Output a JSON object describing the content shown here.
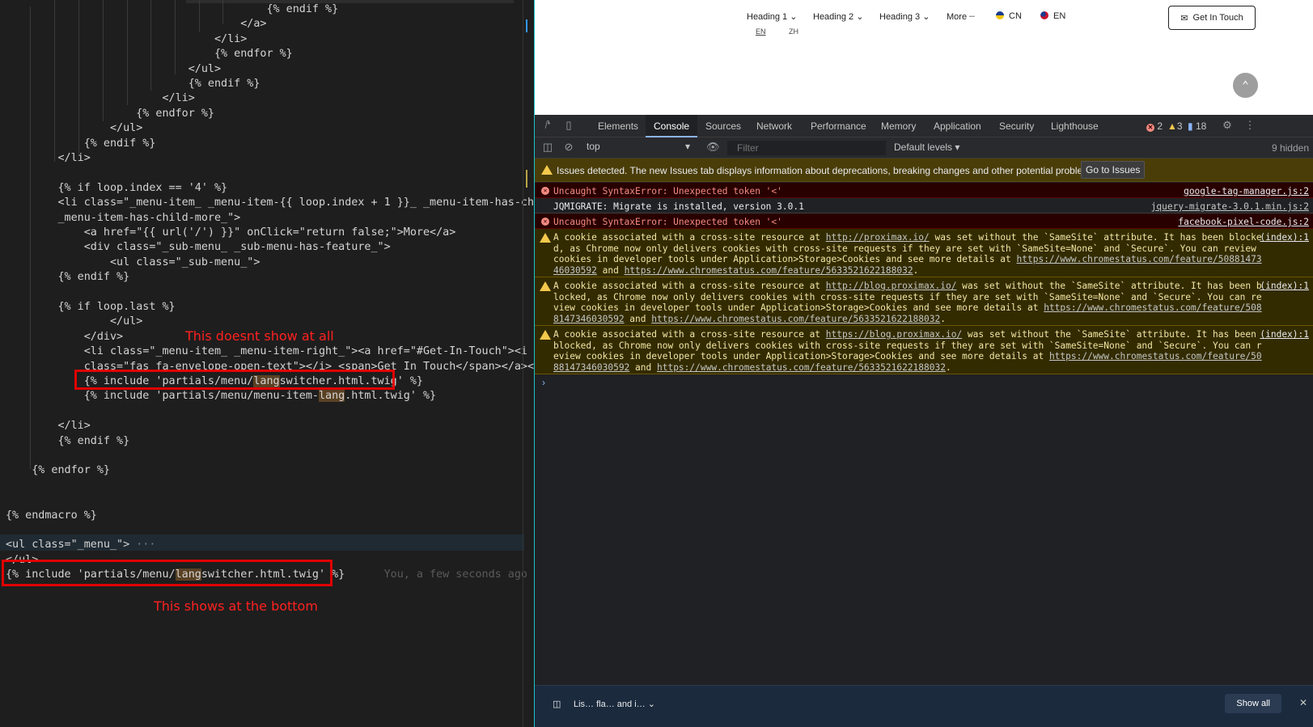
{
  "editor": {
    "lines": [
      {
        "text": "                                        {% endif %}"
      },
      {
        "text": "                                    </a>"
      },
      {
        "text": "                                </li>"
      },
      {
        "text": "                                {% endfor %}"
      },
      {
        "text": "                            </ul>"
      },
      {
        "text": "                            {% endif %}"
      },
      {
        "text": "                        </li>"
      },
      {
        "text": "                    {% endfor %}"
      },
      {
        "text": "                </ul>"
      },
      {
        "text": "            {% endif %}"
      },
      {
        "text": "        </li>"
      },
      {
        "text": ""
      },
      {
        "text": "        {% if loop.index == '4' %}"
      },
      {
        "text": "        <li class=\"_menu-item_ _menu-item-{{ loop.index + 1 }}_ _menu-item-has-child_"
      },
      {
        "text": "        _menu-item-has-child-more_\">"
      },
      {
        "text": "            <a href=\"{{ url('/') }}\" onClick=\"return false;\">More</a>"
      },
      {
        "text": "            <div class=\"_sub-menu_ _sub-menu-has-feature_\">"
      },
      {
        "text": "                <ul class=\"_sub-menu_\">"
      },
      {
        "text": "        {% endif %}"
      },
      {
        "text": ""
      },
      {
        "text": "        {% if loop.last %}"
      },
      {
        "text": "                </ul>"
      },
      {
        "text": "            </div>"
      },
      {
        "text": "            <li class=\"_menu-item_ _menu-item-right_\"><a href=\"#Get-In-Touch\"><i"
      },
      {
        "text": "            class=\"fas fa-envelope-open-text\"></i> <span>Get In Touch</span></a></li>"
      },
      {
        "text": "            {% include 'partials/menu/",
        "hl": "lang",
        "post": "switcher.html.twig' %}"
      },
      {
        "text": "            {% include 'partials/menu/menu-item-",
        "hl": "lang",
        "post": ".html.twig' %}"
      },
      {
        "text": ""
      },
      {
        "text": "        </li>"
      },
      {
        "text": "        {% endif %}"
      },
      {
        "text": ""
      },
      {
        "text": "    {% endfor %}"
      },
      {
        "text": ""
      },
      {
        "text": ""
      },
      {
        "text": "{% endmacro %}"
      },
      {
        "text": ""
      },
      {
        "text": "<ul class=\"_menu_\">",
        "fold": " ···"
      },
      {
        "text": "</ul>"
      },
      {
        "text": "{% include 'partials/menu/",
        "hl": "lang",
        "post": "switcher.html.twig' %}",
        "blame": "      You, a few seconds ago • Unc"
      }
    ],
    "annotation_top": "This doesnt show at all",
    "annotation_bottom": "This shows at the bottom"
  },
  "page": {
    "nav": [
      "Heading 1 ⌄",
      "Heading 2 ⌄",
      "Heading 3 ⌄",
      "More ┄",
      "CN",
      "EN"
    ],
    "lang_sub": [
      "EN",
      "ZH"
    ],
    "cta": "Get In Touch",
    "colors": {
      "flag_cn": "#1a3c8f",
      "flag_en": "#c8102e"
    }
  },
  "devtools": {
    "tabs": [
      "Elements",
      "Console",
      "Sources",
      "Network",
      "Performance",
      "Memory",
      "Application",
      "Security",
      "Lighthouse"
    ],
    "active_tab": "Console",
    "counts": {
      "errors": "2",
      "warnings": "3",
      "info": "18"
    },
    "context": "top",
    "filter_placeholder": "Filter",
    "levels": "Default levels ▾",
    "hidden": "9 hidden",
    "issues_text": "Issues detected. The new Issues tab displays information about deprecations, breaking changes and other potential problems.",
    "issues_button": "Go to Issues",
    "messages": [
      {
        "level": "error",
        "text": "Uncaught SyntaxError: Unexpected token '<'",
        "src": "google-tag-manager.js:2"
      },
      {
        "level": "info",
        "text": "JQMIGRATE: Migrate is installed, version 3.0.1",
        "src": "jquery-migrate-3.0.1.min.js:2"
      },
      {
        "level": "error",
        "text": "Uncaught SyntaxError: Unexpected token '<'",
        "src": "facebook-pixel-code.js:2"
      },
      {
        "level": "warn",
        "pre": "A cookie associated with a cross-site resource at ",
        "url1": "http://proximax.io/",
        "mid": " was set without the `SameSite` attribute. It has been blocked, as Chrome now only delivers cookies with cross-site requests if they are set with `SameSite=None` and `Secure`. You can review cookies in developer tools under Application>Storage>Cookies and see more details at ",
        "url2": "https://www.chromestatus.com/feature/5088147346030592",
        "and": " and ",
        "url3": "https://www.chromestatus.com/feature/5633521622188032",
        "end": ".",
        "src": "(index):1"
      },
      {
        "level": "warn",
        "pre": "A cookie associated with a cross-site resource at ",
        "url1": "http://blog.proximax.io/",
        "mid": " was set without the `SameSite` attribute. It has been blocked, as Chrome now only delivers cookies with cross-site requests if they are set with `SameSite=None` and `Secure`. You can review cookies in developer tools under Application>Storage>Cookies and see more details at ",
        "url2": "https://www.chromestatus.com/feature/5088147346030592",
        "and": " and ",
        "url3": "https://www.chromestatus.com/feature/5633521622188032",
        "end": ".",
        "src": "(index):1"
      },
      {
        "level": "warn",
        "pre": "A cookie associated with a cross-site resource at ",
        "url1": "https://blog.proximax.io/",
        "mid": " was set without the `SameSite` attribute. It has been blocked, as Chrome now only delivers cookies with cross-site requests if they are set with `SameSite=None` and `Secure`. You can review cookies in developer tools under Application>Storage>Cookies and see more details at ",
        "url2": "https://www.chromestatus.com/feature/5088147346030592",
        "and": " and ",
        "url3": "https://www.chromestatus.com/feature/5633521622188032",
        "end": ".",
        "src": "(index):1"
      }
    ],
    "prompt": "›",
    "drawer": {
      "item": "Lis… fla… and i… ⌄",
      "show_all": "Show all",
      "close": "✕"
    }
  }
}
